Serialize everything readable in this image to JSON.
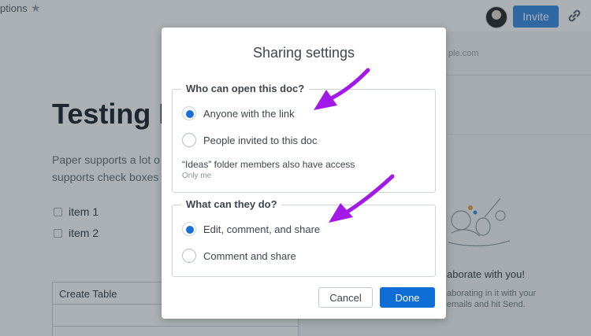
{
  "background": {
    "doc_name": "ptions",
    "invite_label": "Invite",
    "title": "Testing P",
    "paragraph": [
      "Paper supports a lot o",
      "supports check boxes"
    ],
    "checklist": [
      "item 1",
      "item 2"
    ],
    "table_header": "Create Table",
    "side_email": "ple.com",
    "side_heading": "aborate with you!",
    "side_body": [
      "aborating in it with your",
      "emails and hit Send."
    ],
    "icons": [
      "star-icon",
      "link-icon",
      "avatar"
    ]
  },
  "dialog": {
    "title": "Sharing settings",
    "access": {
      "legend": "Who can open this doc?",
      "options": [
        {
          "label": "Anyone with the link",
          "selected": true
        },
        {
          "label": "People invited to this doc",
          "selected": false
        }
      ],
      "note": "“Ideas” folder members also have access",
      "note_sub": "Only me"
    },
    "permissions": {
      "legend": "What can they do?",
      "options": [
        {
          "label": "Edit, comment, and share",
          "selected": true
        },
        {
          "label": "Comment and share",
          "selected": false
        }
      ]
    },
    "cancel_label": "Cancel",
    "done_label": "Done"
  },
  "colors": {
    "primary": "#0f6ed5",
    "invite": "#3d8ee3",
    "annotation_arrow": "#a319e8"
  }
}
